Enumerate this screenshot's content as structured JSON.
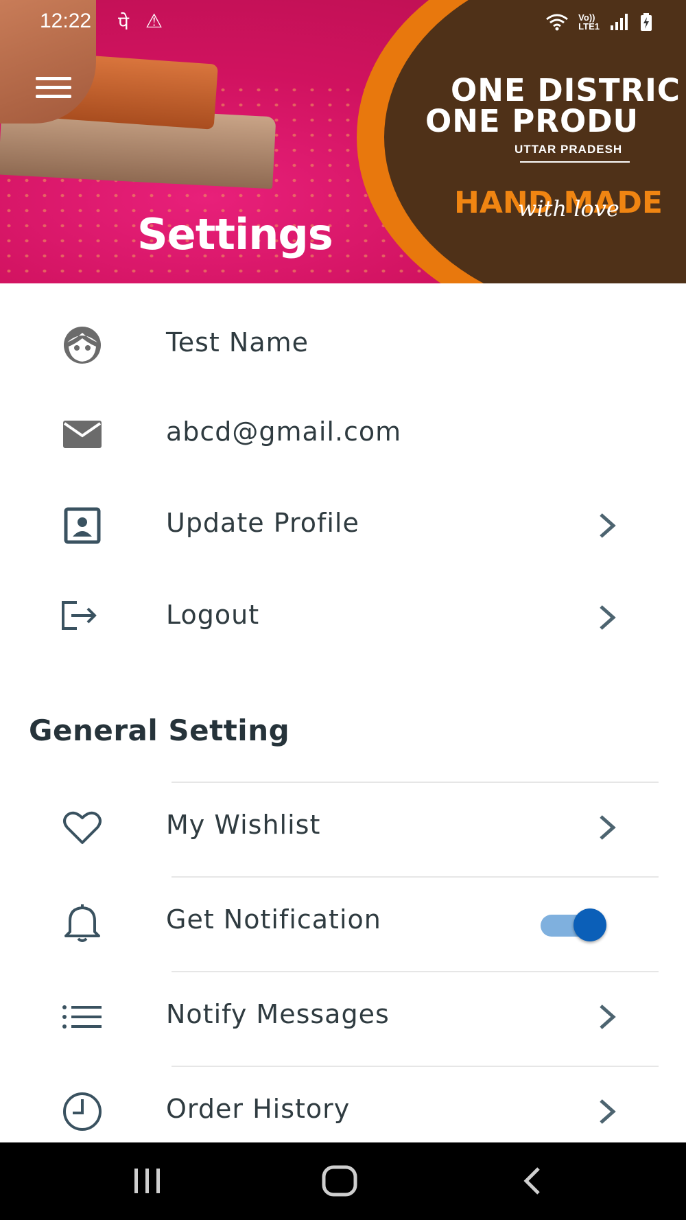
{
  "status_bar": {
    "time": "12:22",
    "glyph": "पे",
    "warning_icon": "warning-icon",
    "right_icons": [
      "wifi-icon",
      "volte-icon",
      "signal-icon",
      "battery-icon"
    ],
    "volte_label": "Vo))\nLTE1"
  },
  "header": {
    "title": "Settings",
    "menu_icon": "hamburger-menu-icon",
    "banner": {
      "line1": "ONE DISTRIC",
      "line2": "ONE PRODU",
      "sub": "UTTAR PRADESH",
      "handmade": "HAND MADE",
      "with_love": "with love"
    },
    "colors": {
      "banner_orange": "#e8780d",
      "banner_brown": "#4f3118",
      "fabric_pink": "#d0125f"
    }
  },
  "account": {
    "items": [
      {
        "icon": "face-icon",
        "label": "Test Name",
        "chevron": false
      },
      {
        "icon": "mail-icon",
        "label": "abcd@gmail.com",
        "chevron": false
      },
      {
        "icon": "profile-card-icon",
        "label": "Update Profile",
        "chevron": true
      },
      {
        "icon": "logout-icon",
        "label": "Logout",
        "chevron": true
      }
    ]
  },
  "general": {
    "title": "General Setting",
    "items": [
      {
        "icon": "heart-icon",
        "label": "My Wishlist",
        "chevron": true
      },
      {
        "icon": "bell-icon",
        "label": "Get Notification",
        "toggle": true,
        "toggle_on": true
      },
      {
        "icon": "list-icon",
        "label": "Notify Messages",
        "chevron": true
      },
      {
        "icon": "clock-icon",
        "label": "Order History",
        "chevron": true
      }
    ]
  },
  "toggle_colors": {
    "track": "#7fb0de",
    "knob": "#0b5fb8"
  },
  "nav_bar": {
    "buttons": [
      "recent-apps-icon",
      "home-icon",
      "back-icon"
    ]
  }
}
